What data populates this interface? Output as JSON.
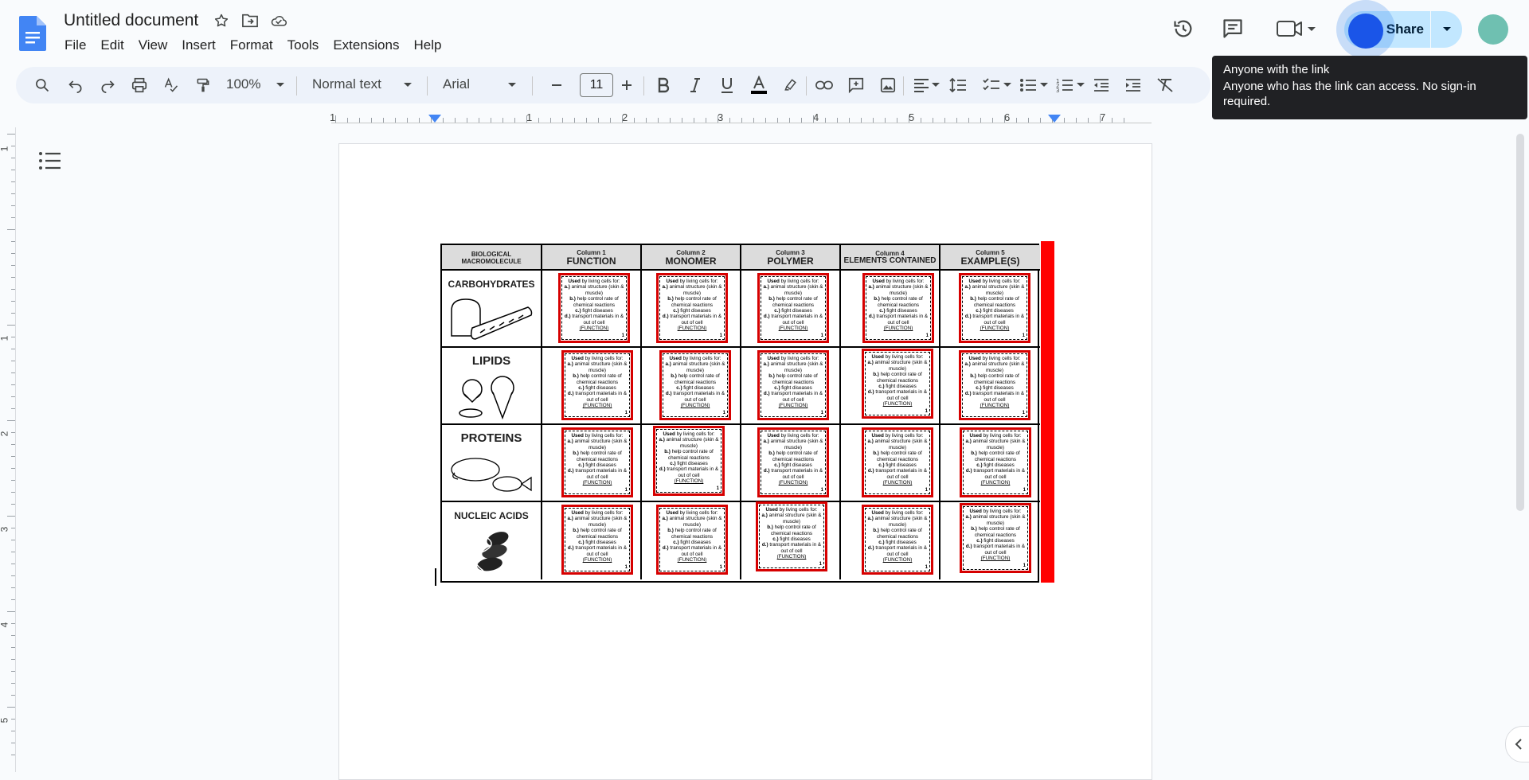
{
  "document": {
    "title": "Untitled document"
  },
  "menu": [
    "File",
    "Edit",
    "View",
    "Insert",
    "Format",
    "Tools",
    "Extensions",
    "Help"
  ],
  "share": {
    "label": "Share"
  },
  "tooltip": {
    "title": "Anyone with the link",
    "body": "Anyone who has the link can access. No sign-in required."
  },
  "toolbar": {
    "zoom": "100%",
    "style": "Normal text",
    "font": "Arial",
    "font_size": "11"
  },
  "ruler": {
    "numbers": [
      "1",
      "1",
      "2",
      "3",
      "4",
      "5",
      "6",
      "7"
    ]
  },
  "vruler": {
    "numbers": [
      "1",
      "1",
      "2",
      "3",
      "4",
      "5"
    ]
  },
  "worksheet": {
    "corner_header": "BIOLOGICAL MACROMOLECULE",
    "columns": [
      {
        "small": "Column 1",
        "big": "FUNCTION"
      },
      {
        "small": "Column 2",
        "big": "MONOMER"
      },
      {
        "small": "Column 3",
        "big": "POLYMER"
      },
      {
        "small": "Column 4",
        "big": "ELEMENTS CONTAINED"
      },
      {
        "small": "Column 5",
        "big": "EXAMPLE(S)"
      }
    ],
    "rows": [
      "CARBOHYDRATES",
      "LIPIDS",
      "PROTEINS",
      "NUCLEIC ACIDS"
    ],
    "card": {
      "lead": "Used",
      "lead_rest": " by living cells for:",
      "a_key": "a.)",
      "a": " animal structure (skin & muscle)",
      "b_key": "b.)",
      "b": " help control rate of chemical reactions",
      "c_key": "c.)",
      "c": " fight diseases",
      "d_key": "d.)",
      "d": " transport materials in & out of cell",
      "fn": "(FUNCTION)",
      "num": "1"
    }
  },
  "colors": {
    "accent": "#1a73e8",
    "share_bg": "#c2e7ff",
    "card_border": "#d60000",
    "red_bar": "#ff0000"
  },
  "icons": [
    "docs-logo-icon",
    "star-icon",
    "move-to-folder-icon",
    "cloud-status-icon",
    "history-icon",
    "comment-icon",
    "meet-icon",
    "search-icon",
    "undo-icon",
    "redo-icon",
    "print-icon",
    "spellcheck-icon",
    "paint-format-icon",
    "bold-icon",
    "italic-icon",
    "underline-icon",
    "text-color-icon",
    "highlight-icon",
    "link-icon",
    "add-comment-icon",
    "insert-image-icon",
    "align-icon",
    "line-spacing-icon",
    "checklist-icon",
    "bulleted-list-icon",
    "numbered-list-icon",
    "decrease-indent-icon",
    "increase-indent-icon",
    "clear-formatting-icon",
    "outline-icon"
  ]
}
